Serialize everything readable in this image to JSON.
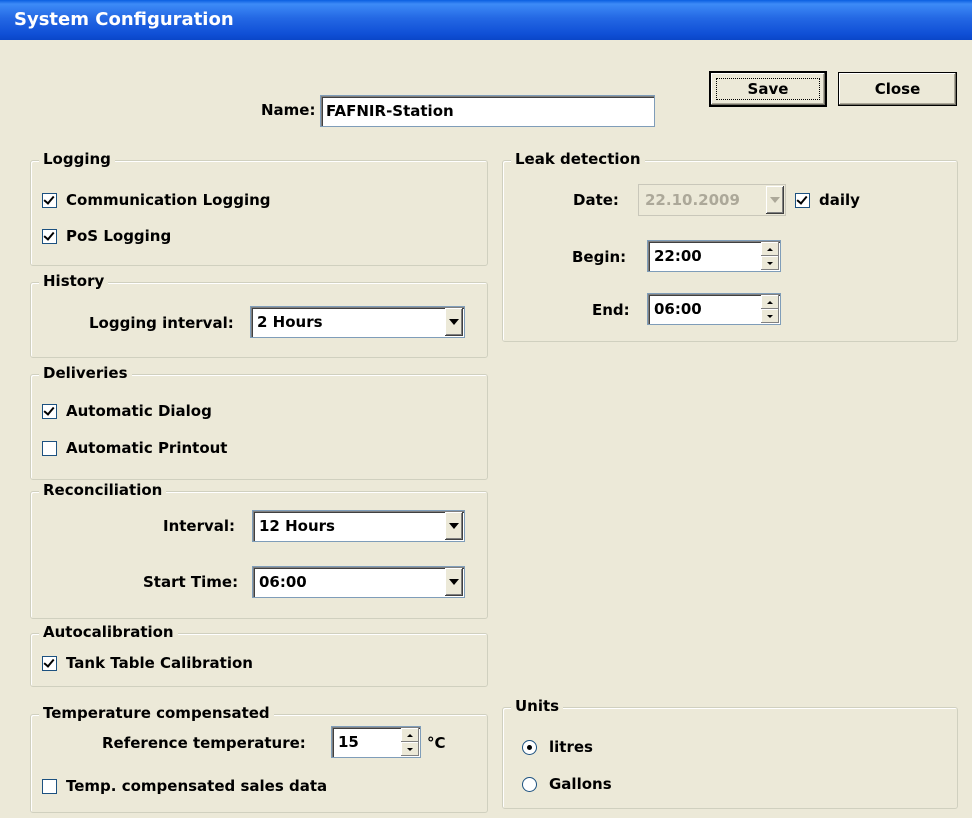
{
  "window": {
    "title": "System Configuration"
  },
  "toolbar": {
    "save_label": "Save",
    "close_label": "Close"
  },
  "name": {
    "label": "Name:",
    "value": "FAFNIR-Station"
  },
  "logging": {
    "title": "Logging",
    "communication": {
      "label": "Communication Logging",
      "checked": true
    },
    "pos": {
      "label": "PoS Logging",
      "checked": true
    }
  },
  "history": {
    "title": "History",
    "interval_label": "Logging interval:",
    "interval_value": "2 Hours"
  },
  "deliveries": {
    "title": "Deliveries",
    "auto_dialog": {
      "label": "Automatic Dialog",
      "checked": true
    },
    "auto_printout": {
      "label": "Automatic Printout",
      "checked": false
    }
  },
  "reconciliation": {
    "title": "Reconciliation",
    "interval_label": "Interval:",
    "interval_value": "12 Hours",
    "start_label": "Start Time:",
    "start_value": "06:00"
  },
  "autocalibration": {
    "title": "Autocalibration",
    "tank_table": {
      "label": "Tank Table Calibration",
      "checked": true
    }
  },
  "temperature": {
    "title": "Temperature compensated",
    "ref_label": "Reference temperature:",
    "ref_value": "15",
    "unit": "°C",
    "sales_data": {
      "label": "Temp. compensated sales data",
      "checked": false
    }
  },
  "leak": {
    "title": "Leak detection",
    "date_label": "Date:",
    "date_value": "22.10.2009",
    "daily": {
      "label": "daily",
      "checked": true
    },
    "begin_label": "Begin:",
    "begin_value": "22:00",
    "end_label": "End:",
    "end_value": "06:00"
  },
  "units": {
    "title": "Units",
    "options": [
      {
        "label": "litres",
        "selected": true
      },
      {
        "label": "Gallons",
        "selected": false
      }
    ]
  }
}
